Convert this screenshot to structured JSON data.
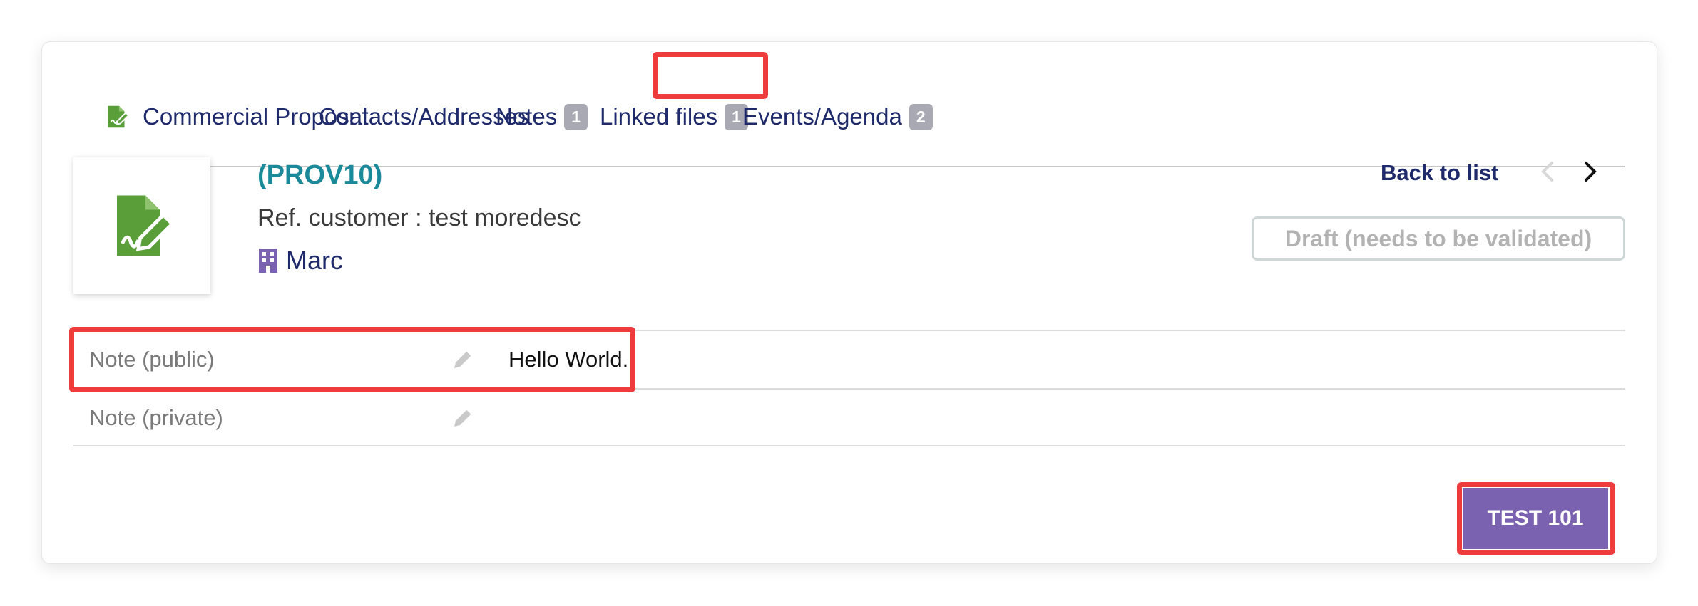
{
  "tabs": [
    {
      "label": "Commercial Proposal",
      "icon": "proposal-edit-icon"
    },
    {
      "label": "Contacts/Addresses"
    },
    {
      "label": "Notes",
      "badge": "1"
    },
    {
      "label": "Linked files",
      "badge": "1"
    },
    {
      "label": "Events/Agenda",
      "badge": "2"
    }
  ],
  "header": {
    "ref": "(PROV10)",
    "ref_customer": "Ref. customer : test moredesc",
    "thirdparty": "Marc",
    "back_to_list": "Back to list",
    "status": "Draft (needs to be validated)"
  },
  "notes": [
    {
      "label": "Note (public)",
      "value": "Hello World."
    },
    {
      "label": "Note (private)",
      "value": ""
    }
  ],
  "actions": {
    "custom_button": "TEST 101"
  },
  "colors": {
    "accent": "#7b62b0",
    "ref_link": "#1a8a9a",
    "nav_text": "#1f2a6b",
    "icon_green": "#5a9e3a",
    "highlight": "#ee3b3b"
  }
}
